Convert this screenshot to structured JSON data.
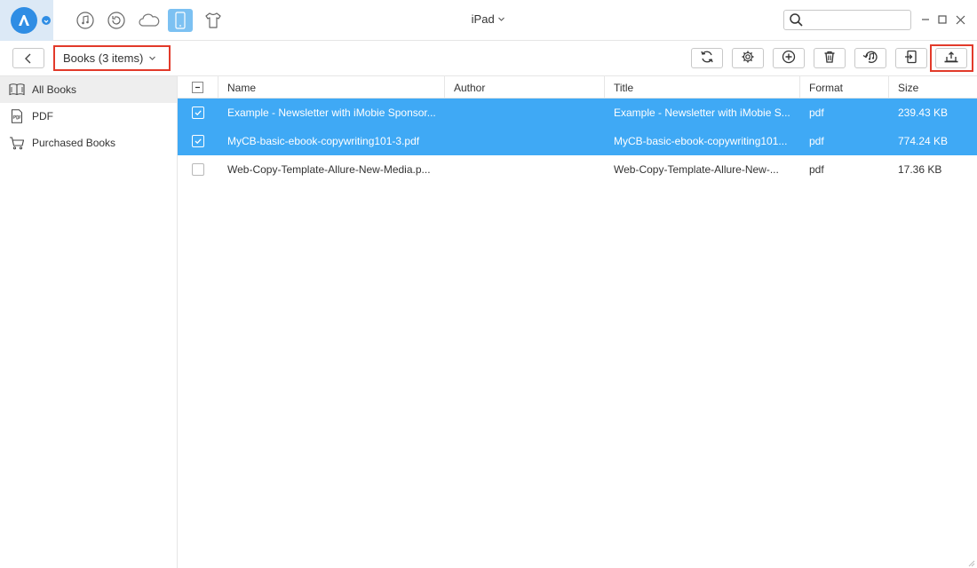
{
  "device": {
    "title": "iPad"
  },
  "search": {
    "placeholder": "",
    "value": ""
  },
  "nav": {
    "icons": [
      "music-icon",
      "restore-icon",
      "cloud-icon",
      "device-icon",
      "shirt-icon"
    ],
    "active": "device-icon"
  },
  "toolbar": {
    "category_label": "Books (3 items)",
    "actions": [
      "refresh-icon",
      "settings-icon",
      "add-icon",
      "delete-icon",
      "itunes-icon",
      "send-to-device-icon",
      "send-to-computer-icon"
    ]
  },
  "sidebar": {
    "items": [
      {
        "label": "All Books",
        "icon": "book-open-icon",
        "selected": true
      },
      {
        "label": "PDF",
        "icon": "pdf-icon",
        "selected": false
      },
      {
        "label": "Purchased Books",
        "icon": "cart-icon",
        "selected": false
      }
    ]
  },
  "table": {
    "columns": [
      "Name",
      "Author",
      "Title",
      "Format",
      "Size"
    ],
    "rows": [
      {
        "selected": true,
        "name": "Example - Newsletter with iMobie Sponsor...",
        "author": "",
        "title": "Example - Newsletter with iMobie S...",
        "format": "pdf",
        "size": "239.43 KB"
      },
      {
        "selected": true,
        "name": "MyCB-basic-ebook-copywriting101-3.pdf",
        "author": "",
        "title": "MyCB-basic-ebook-copywriting101...",
        "format": "pdf",
        "size": "774.24 KB"
      },
      {
        "selected": false,
        "name": "Web-Copy-Template-Allure-New-Media.p...",
        "author": "",
        "title": "Web-Copy-Template-Allure-New-...",
        "format": "pdf",
        "size": "17.36 KB"
      }
    ]
  },
  "colors": {
    "accent": "#3fa9f5",
    "highlight": "#e23a2a",
    "logo": "#2f8de4"
  }
}
